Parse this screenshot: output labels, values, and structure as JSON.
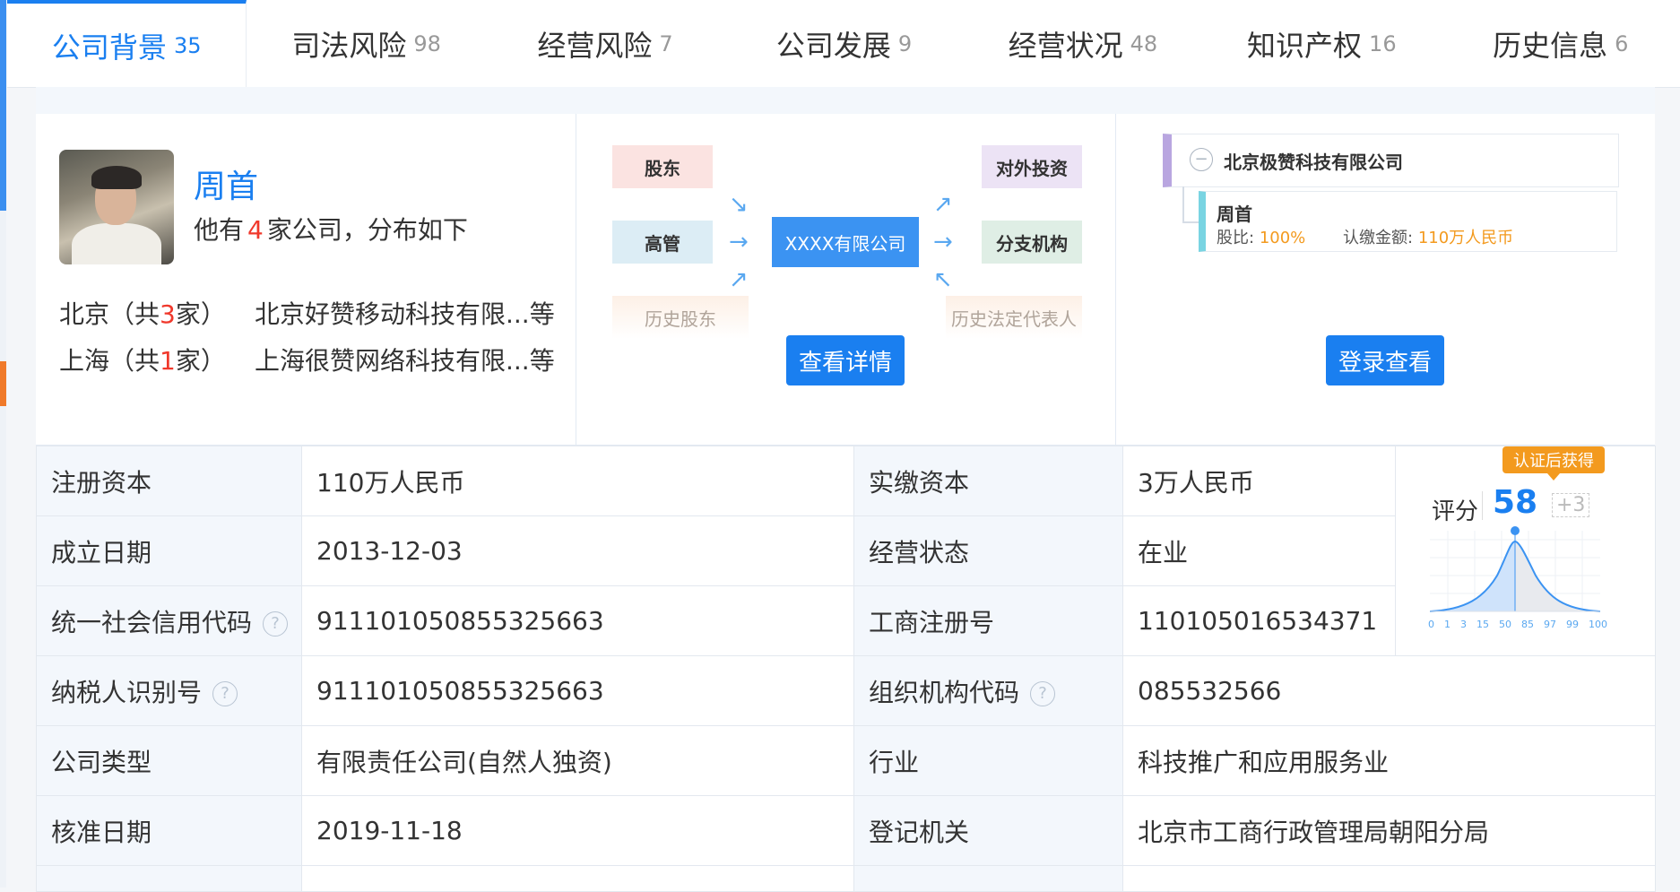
{
  "tabs": [
    {
      "label": "公司背景",
      "count": "35",
      "active": true
    },
    {
      "label": "司法风险",
      "count": "98"
    },
    {
      "label": "经营风险",
      "count": "7"
    },
    {
      "label": "公司发展",
      "count": "9"
    },
    {
      "label": "经营状况",
      "count": "48"
    },
    {
      "label": "知识产权",
      "count": "16"
    },
    {
      "label": "历史信息",
      "count": "6"
    }
  ],
  "legal_rep": {
    "name": "周首",
    "sub_prefix": "他有",
    "company_count": "4",
    "sub_suffix": "家公司，分布如下",
    "locations": [
      {
        "city": "北京（共",
        "n": "3",
        "suffix": "家）",
        "company": "北京好赞移动科技有限...等"
      },
      {
        "city": "上海（共",
        "n": "1",
        "suffix": "家）",
        "company": "上海很赞网络科技有限...等"
      }
    ]
  },
  "relation": {
    "shareholder": "股东",
    "executive": "高管",
    "history_shareholder": "历史股东",
    "center": "XXXX有限公司",
    "investment": "对外投资",
    "branch": "分支机构",
    "history_rep": "历史法定代表人",
    "button": "查看详情"
  },
  "equity": {
    "root": "北京极赞科技有限公司",
    "holder": "周首",
    "ratio_label": "股比:",
    "ratio": "100%",
    "amount_label": "认缴金额:",
    "amount": "110万人民币",
    "button": "登录查看"
  },
  "info": {
    "reg_capital_label": "注册资本",
    "reg_capital": "110万人民币",
    "paid_capital_label": "实缴资本",
    "paid_capital": "3万人民币",
    "found_date_label": "成立日期",
    "found_date": "2013-12-03",
    "status_label": "经营状态",
    "status": "在业",
    "credit_code_label": "统一社会信用代码",
    "credit_code": "911101050855325663",
    "biz_reg_label": "工商注册号",
    "biz_reg": "110105016534371",
    "taxpayer_label": "纳税人识别号",
    "taxpayer": "911101050855325663",
    "org_code_label": "组织机构代码",
    "org_code": "085532566",
    "company_type_label": "公司类型",
    "company_type": "有限责任公司(自然人独资)",
    "industry_label": "行业",
    "industry": "科技推广和应用服务业",
    "approve_date_label": "核准日期",
    "approve_date": "2019-11-18",
    "authority_label": "登记机关",
    "authority": "北京市工商行政管理局朝阳分局"
  },
  "score": {
    "badge": "认证后获得",
    "label": "评分",
    "value": "58",
    "plus": "+3",
    "axis": [
      "0",
      "1",
      "3",
      "15",
      "50",
      "85",
      "97",
      "99",
      "100"
    ]
  },
  "colors": {
    "accent": "#1a7ff0",
    "red": "#f0382b",
    "orange": "#f39a1e"
  }
}
